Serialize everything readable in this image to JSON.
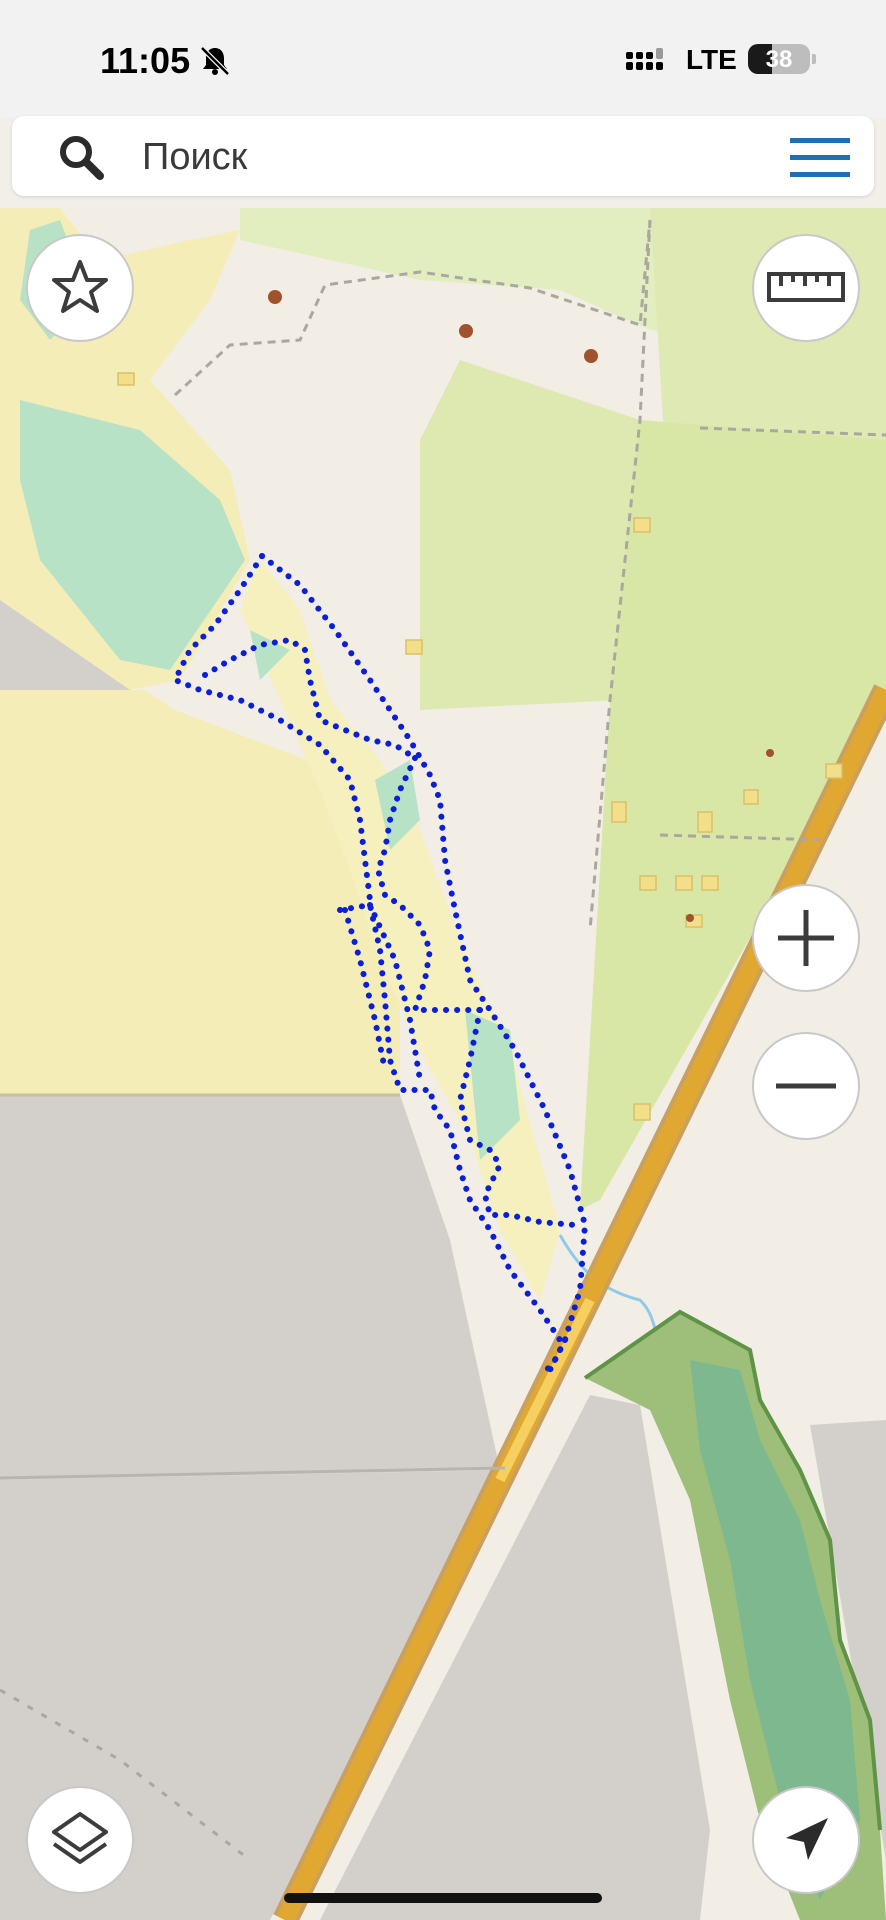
{
  "status_bar": {
    "time": "11:05",
    "network": "LTE",
    "battery_level": "38",
    "battery_fraction": 0.38,
    "silent_icon": "bell-slash-icon",
    "signal_icon": "cellular-signal-icon"
  },
  "search": {
    "placeholder": "Поиск",
    "search_icon": "search-icon",
    "menu_icon": "hamburger-menu-icon",
    "menu_color": "#1f6fb2"
  },
  "map": {
    "route_color": "#0b1fd6",
    "highway_color": "#e0a830",
    "buttons": {
      "favorites": "star-icon",
      "ruler": "ruler-icon",
      "zoom_in": "plus-icon",
      "zoom_out": "minus-icon",
      "layers": "layers-icon",
      "locate": "navigation-arrow-icon"
    }
  }
}
